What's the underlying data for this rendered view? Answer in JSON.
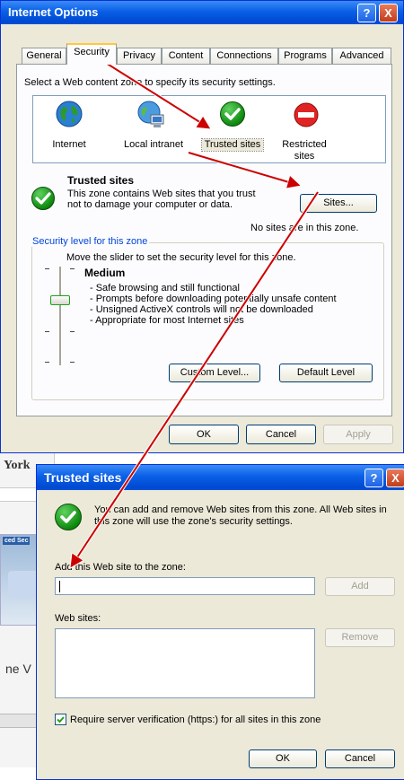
{
  "colors": {
    "xp_blue": "#0a5fe8",
    "face": "#ece9d8",
    "arrow_red": "#cc0000",
    "check_green": "#118811",
    "stop_red": "#d71a1a"
  },
  "internet_options": {
    "title": "Internet Options",
    "help_glyph": "?",
    "close_glyph": "X",
    "tabs": [
      {
        "label": "General"
      },
      {
        "label": "Security",
        "active": true
      },
      {
        "label": "Privacy"
      },
      {
        "label": "Content"
      },
      {
        "label": "Connections"
      },
      {
        "label": "Programs"
      },
      {
        "label": "Advanced"
      }
    ],
    "zone_prompt": "Select a Web content zone to specify its security settings.",
    "zones": [
      {
        "label": "Internet",
        "icon": "globe-icon"
      },
      {
        "label": "Local intranet",
        "icon": "network-icon"
      },
      {
        "label": "Trusted sites",
        "icon": "green-check-icon",
        "selected": true
      },
      {
        "label": "Restricted sites",
        "icon": "stop-icon"
      }
    ],
    "zone_title": "Trusted sites",
    "zone_description": "This zone contains Web sites that you trust not to damage your computer or data.",
    "sites_button": "Sites...",
    "no_sites": "No sites are in this zone.",
    "security_group": {
      "legend": "Security level for this zone",
      "slider_prompt": "Move the slider to set the security level for this zone.",
      "level": "Medium",
      "slider_level_fraction": 0.5,
      "bullets": [
        "- Safe browsing and still functional",
        "- Prompts before downloading potentially unsafe content",
        "- Unsigned ActiveX controls will not be downloaded",
        "- Appropriate for most Internet sites"
      ],
      "custom_button": "Custom Level...",
      "default_button": "Default Level"
    },
    "ok_button": "OK",
    "cancel_button": "Cancel",
    "apply_button": "Apply"
  },
  "background": {
    "fragment_title": "York",
    "fragment_text": "ne V",
    "fragment_tag": "ced Sec"
  },
  "trusted_sites": {
    "title": "Trusted sites",
    "help_glyph": "?",
    "close_glyph": "X",
    "info": "You can add and remove Web sites from this zone. All Web sites in this zone will use the zone's security settings.",
    "add_label": "Add this Web site to the zone:",
    "add_value": "",
    "add_button": "Add",
    "websites_label": "Web sites:",
    "remove_button": "Remove",
    "require_https_label": "Require server verification (https:) for all sites in this zone",
    "require_https_checked": true,
    "ok_button": "OK",
    "cancel_button": "Cancel"
  }
}
